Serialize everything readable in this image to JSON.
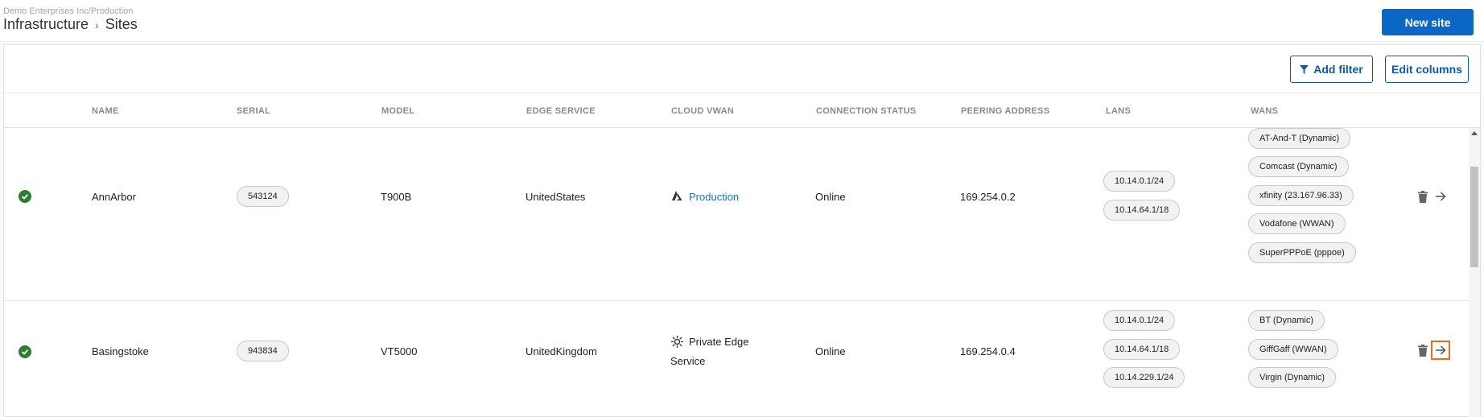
{
  "header": {
    "org_path": "Demo Enterprises Inc/Production",
    "breadcrumb": [
      "Infrastructure",
      "Sites"
    ],
    "separator": "›",
    "new_site_label": "New site"
  },
  "toolbar": {
    "add_filter_label": "Add filter",
    "edit_columns_label": "Edit columns"
  },
  "columns": [
    "NAME",
    "SERIAL",
    "MODEL",
    "EDGE SERVICE",
    "CLOUD VWAN",
    "CONNECTION STATUS",
    "PEERING ADDRESS",
    "LANS",
    "WANS"
  ],
  "rows": [
    {
      "name": "AnnArbor",
      "serial": "543124",
      "model": "T900B",
      "edge_service": "UnitedStates",
      "cloud_vwan": "Production",
      "cloud_vwan_icon": "azure-icon",
      "connection_status": "Online",
      "peering_address": "169.254.0.2",
      "lans": [
        "10.14.0.1/24",
        "10.14.64.1/18"
      ],
      "wans": [
        "AT-And-T (Dynamic)",
        "Comcast (Dynamic)",
        "xfinity (23.167.96.33)",
        "Vodafone (WWAN)",
        "SuperPPPoE (pppoe)"
      ]
    },
    {
      "name": "Basingstoke",
      "serial": "943834",
      "model": "VT5000",
      "edge_service": "UnitedKingdom",
      "cloud_vwan_line1": "Private Edge",
      "cloud_vwan_line2": "Service",
      "cloud_vwan_icon": "private-edge-icon",
      "connection_status": "Online",
      "peering_address": "169.254.0.4",
      "lans": [
        "10.14.0.1/24",
        "10.14.64.1/18",
        "10.14.229.1/24"
      ],
      "wans": [
        "BT (Dynamic)",
        "GiffGaff (WWAN)",
        "Virgin (Dynamic)"
      ]
    }
  ],
  "colors": {
    "primary": "#0a67c5",
    "online_green": "#2e7d32",
    "link": "#1f70c1",
    "focus_outline": "#ef6c1a"
  }
}
